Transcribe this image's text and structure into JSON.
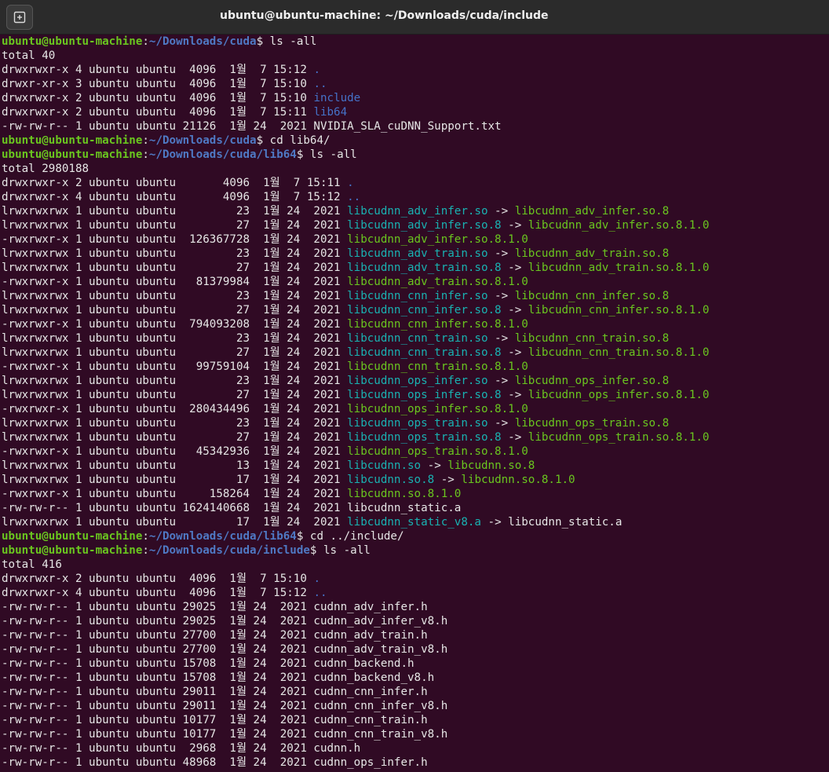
{
  "window": {
    "title": "ubuntu@ubuntu-machine: ~/Downloads/cuda/include",
    "new_tab_icon": "new-tab-icon"
  },
  "colors": {
    "background": "#300a24",
    "prompt_user": "#6ac61f",
    "prompt_path": "#4f79c4",
    "directory": "#4572c8",
    "symlink": "#19b2b2",
    "executable": "#6ac61f",
    "text": "#e6e6e6"
  },
  "terminal": {
    "lines": [
      [
        {
          "t": "ubuntu@ubuntu-machine",
          "c": "pu"
        },
        {
          "t": ":",
          "c": "plain"
        },
        {
          "t": "~/Downloads/cuda",
          "c": "pp"
        },
        {
          "t": "$ ls -all",
          "c": "plain"
        }
      ],
      [
        {
          "t": "total 40",
          "c": "plain"
        }
      ],
      [
        {
          "t": "drwxrwxr-x 4 ubuntu ubuntu  4096  1월  7 15:12 ",
          "c": "plain"
        },
        {
          "t": ".",
          "c": "dir"
        }
      ],
      [
        {
          "t": "drwxr-xr-x 3 ubuntu ubuntu  4096  1월  7 15:10 ",
          "c": "plain"
        },
        {
          "t": "..",
          "c": "dir"
        }
      ],
      [
        {
          "t": "drwxrwxr-x 2 ubuntu ubuntu  4096  1월  7 15:10 ",
          "c": "plain"
        },
        {
          "t": "include",
          "c": "dir"
        }
      ],
      [
        {
          "t": "drwxrwxr-x 2 ubuntu ubuntu  4096  1월  7 15:11 ",
          "c": "plain"
        },
        {
          "t": "lib64",
          "c": "dir"
        }
      ],
      [
        {
          "t": "-rw-rw-r-- 1 ubuntu ubuntu 21126  1월 24  2021 NVIDIA_SLA_cuDNN_Support.txt",
          "c": "plain"
        }
      ],
      [
        {
          "t": "ubuntu@ubuntu-machine",
          "c": "pu"
        },
        {
          "t": ":",
          "c": "plain"
        },
        {
          "t": "~/Downloads/cuda",
          "c": "pp"
        },
        {
          "t": "$ cd lib64/",
          "c": "plain"
        }
      ],
      [
        {
          "t": "ubuntu@ubuntu-machine",
          "c": "pu"
        },
        {
          "t": ":",
          "c": "plain"
        },
        {
          "t": "~/Downloads/cuda/lib64",
          "c": "pp"
        },
        {
          "t": "$ ls -all",
          "c": "plain"
        }
      ],
      [
        {
          "t": "total 2980188",
          "c": "plain"
        }
      ],
      [
        {
          "t": "drwxrwxr-x 2 ubuntu ubuntu       4096  1월  7 15:11 ",
          "c": "plain"
        },
        {
          "t": ".",
          "c": "dir"
        }
      ],
      [
        {
          "t": "drwxrwxr-x 4 ubuntu ubuntu       4096  1월  7 15:12 ",
          "c": "plain"
        },
        {
          "t": "..",
          "c": "dir"
        }
      ],
      [
        {
          "t": "lrwxrwxrwx 1 ubuntu ubuntu         23  1월 24  2021 ",
          "c": "plain"
        },
        {
          "t": "libcudnn_adv_infer.so",
          "c": "link"
        },
        {
          "t": " -> ",
          "c": "plain"
        },
        {
          "t": "libcudnn_adv_infer.so.8",
          "c": "exe"
        }
      ],
      [
        {
          "t": "lrwxrwxrwx 1 ubuntu ubuntu         27  1월 24  2021 ",
          "c": "plain"
        },
        {
          "t": "libcudnn_adv_infer.so.8",
          "c": "link"
        },
        {
          "t": " -> ",
          "c": "plain"
        },
        {
          "t": "libcudnn_adv_infer.so.8.1.0",
          "c": "exe"
        }
      ],
      [
        {
          "t": "-rwxrwxr-x 1 ubuntu ubuntu  126367728  1월 24  2021 ",
          "c": "plain"
        },
        {
          "t": "libcudnn_adv_infer.so.8.1.0",
          "c": "exe"
        }
      ],
      [
        {
          "t": "lrwxrwxrwx 1 ubuntu ubuntu         23  1월 24  2021 ",
          "c": "plain"
        },
        {
          "t": "libcudnn_adv_train.so",
          "c": "link"
        },
        {
          "t": " -> ",
          "c": "plain"
        },
        {
          "t": "libcudnn_adv_train.so.8",
          "c": "exe"
        }
      ],
      [
        {
          "t": "lrwxrwxrwx 1 ubuntu ubuntu         27  1월 24  2021 ",
          "c": "plain"
        },
        {
          "t": "libcudnn_adv_train.so.8",
          "c": "link"
        },
        {
          "t": " -> ",
          "c": "plain"
        },
        {
          "t": "libcudnn_adv_train.so.8.1.0",
          "c": "exe"
        }
      ],
      [
        {
          "t": "-rwxrwxr-x 1 ubuntu ubuntu   81379984  1월 24  2021 ",
          "c": "plain"
        },
        {
          "t": "libcudnn_adv_train.so.8.1.0",
          "c": "exe"
        }
      ],
      [
        {
          "t": "lrwxrwxrwx 1 ubuntu ubuntu         23  1월 24  2021 ",
          "c": "plain"
        },
        {
          "t": "libcudnn_cnn_infer.so",
          "c": "link"
        },
        {
          "t": " -> ",
          "c": "plain"
        },
        {
          "t": "libcudnn_cnn_infer.so.8",
          "c": "exe"
        }
      ],
      [
        {
          "t": "lrwxrwxrwx 1 ubuntu ubuntu         27  1월 24  2021 ",
          "c": "plain"
        },
        {
          "t": "libcudnn_cnn_infer.so.8",
          "c": "link"
        },
        {
          "t": " -> ",
          "c": "plain"
        },
        {
          "t": "libcudnn_cnn_infer.so.8.1.0",
          "c": "exe"
        }
      ],
      [
        {
          "t": "-rwxrwxr-x 1 ubuntu ubuntu  794093208  1월 24  2021 ",
          "c": "plain"
        },
        {
          "t": "libcudnn_cnn_infer.so.8.1.0",
          "c": "exe"
        }
      ],
      [
        {
          "t": "lrwxrwxrwx 1 ubuntu ubuntu         23  1월 24  2021 ",
          "c": "plain"
        },
        {
          "t": "libcudnn_cnn_train.so",
          "c": "link"
        },
        {
          "t": " -> ",
          "c": "plain"
        },
        {
          "t": "libcudnn_cnn_train.so.8",
          "c": "exe"
        }
      ],
      [
        {
          "t": "lrwxrwxrwx 1 ubuntu ubuntu         27  1월 24  2021 ",
          "c": "plain"
        },
        {
          "t": "libcudnn_cnn_train.so.8",
          "c": "link"
        },
        {
          "t": " -> ",
          "c": "plain"
        },
        {
          "t": "libcudnn_cnn_train.so.8.1.0",
          "c": "exe"
        }
      ],
      [
        {
          "t": "-rwxrwxr-x 1 ubuntu ubuntu   99759104  1월 24  2021 ",
          "c": "plain"
        },
        {
          "t": "libcudnn_cnn_train.so.8.1.0",
          "c": "exe"
        }
      ],
      [
        {
          "t": "lrwxrwxrwx 1 ubuntu ubuntu         23  1월 24  2021 ",
          "c": "plain"
        },
        {
          "t": "libcudnn_ops_infer.so",
          "c": "link"
        },
        {
          "t": " -> ",
          "c": "plain"
        },
        {
          "t": "libcudnn_ops_infer.so.8",
          "c": "exe"
        }
      ],
      [
        {
          "t": "lrwxrwxrwx 1 ubuntu ubuntu         27  1월 24  2021 ",
          "c": "plain"
        },
        {
          "t": "libcudnn_ops_infer.so.8",
          "c": "link"
        },
        {
          "t": " -> ",
          "c": "plain"
        },
        {
          "t": "libcudnn_ops_infer.so.8.1.0",
          "c": "exe"
        }
      ],
      [
        {
          "t": "-rwxrwxr-x 1 ubuntu ubuntu  280434496  1월 24  2021 ",
          "c": "plain"
        },
        {
          "t": "libcudnn_ops_infer.so.8.1.0",
          "c": "exe"
        }
      ],
      [
        {
          "t": "lrwxrwxrwx 1 ubuntu ubuntu         23  1월 24  2021 ",
          "c": "plain"
        },
        {
          "t": "libcudnn_ops_train.so",
          "c": "link"
        },
        {
          "t": " -> ",
          "c": "plain"
        },
        {
          "t": "libcudnn_ops_train.so.8",
          "c": "exe"
        }
      ],
      [
        {
          "t": "lrwxrwxrwx 1 ubuntu ubuntu         27  1월 24  2021 ",
          "c": "plain"
        },
        {
          "t": "libcudnn_ops_train.so.8",
          "c": "link"
        },
        {
          "t": " -> ",
          "c": "plain"
        },
        {
          "t": "libcudnn_ops_train.so.8.1.0",
          "c": "exe"
        }
      ],
      [
        {
          "t": "-rwxrwxr-x 1 ubuntu ubuntu   45342936  1월 24  2021 ",
          "c": "plain"
        },
        {
          "t": "libcudnn_ops_train.so.8.1.0",
          "c": "exe"
        }
      ],
      [
        {
          "t": "lrwxrwxrwx 1 ubuntu ubuntu         13  1월 24  2021 ",
          "c": "plain"
        },
        {
          "t": "libcudnn.so",
          "c": "link"
        },
        {
          "t": " -> ",
          "c": "plain"
        },
        {
          "t": "libcudnn.so.8",
          "c": "exe"
        }
      ],
      [
        {
          "t": "lrwxrwxrwx 1 ubuntu ubuntu         17  1월 24  2021 ",
          "c": "plain"
        },
        {
          "t": "libcudnn.so.8",
          "c": "link"
        },
        {
          "t": " -> ",
          "c": "plain"
        },
        {
          "t": "libcudnn.so.8.1.0",
          "c": "exe"
        }
      ],
      [
        {
          "t": "-rwxrwxr-x 1 ubuntu ubuntu     158264  1월 24  2021 ",
          "c": "plain"
        },
        {
          "t": "libcudnn.so.8.1.0",
          "c": "exe"
        }
      ],
      [
        {
          "t": "-rw-rw-r-- 1 ubuntu ubuntu 1624140668  1월 24  2021 libcudnn_static.a",
          "c": "plain"
        }
      ],
      [
        {
          "t": "lrwxrwxrwx 1 ubuntu ubuntu         17  1월 24  2021 ",
          "c": "plain"
        },
        {
          "t": "libcudnn_static_v8.a",
          "c": "link"
        },
        {
          "t": " -> libcudnn_static.a",
          "c": "plain"
        }
      ],
      [
        {
          "t": "ubuntu@ubuntu-machine",
          "c": "pu"
        },
        {
          "t": ":",
          "c": "plain"
        },
        {
          "t": "~/Downloads/cuda/lib64",
          "c": "pp"
        },
        {
          "t": "$ cd ../include/",
          "c": "plain"
        }
      ],
      [
        {
          "t": "ubuntu@ubuntu-machine",
          "c": "pu"
        },
        {
          "t": ":",
          "c": "plain"
        },
        {
          "t": "~/Downloads/cuda/include",
          "c": "pp"
        },
        {
          "t": "$ ls -all",
          "c": "plain"
        }
      ],
      [
        {
          "t": "total 416",
          "c": "plain"
        }
      ],
      [
        {
          "t": "drwxrwxr-x 2 ubuntu ubuntu  4096  1월  7 15:10 ",
          "c": "plain"
        },
        {
          "t": ".",
          "c": "dir"
        }
      ],
      [
        {
          "t": "drwxrwxr-x 4 ubuntu ubuntu  4096  1월  7 15:12 ",
          "c": "plain"
        },
        {
          "t": "..",
          "c": "dir"
        }
      ],
      [
        {
          "t": "-rw-rw-r-- 1 ubuntu ubuntu 29025  1월 24  2021 cudnn_adv_infer.h",
          "c": "plain"
        }
      ],
      [
        {
          "t": "-rw-rw-r-- 1 ubuntu ubuntu 29025  1월 24  2021 cudnn_adv_infer_v8.h",
          "c": "plain"
        }
      ],
      [
        {
          "t": "-rw-rw-r-- 1 ubuntu ubuntu 27700  1월 24  2021 cudnn_adv_train.h",
          "c": "plain"
        }
      ],
      [
        {
          "t": "-rw-rw-r-- 1 ubuntu ubuntu 27700  1월 24  2021 cudnn_adv_train_v8.h",
          "c": "plain"
        }
      ],
      [
        {
          "t": "-rw-rw-r-- 1 ubuntu ubuntu 15708  1월 24  2021 cudnn_backend.h",
          "c": "plain"
        }
      ],
      [
        {
          "t": "-rw-rw-r-- 1 ubuntu ubuntu 15708  1월 24  2021 cudnn_backend_v8.h",
          "c": "plain"
        }
      ],
      [
        {
          "t": "-rw-rw-r-- 1 ubuntu ubuntu 29011  1월 24  2021 cudnn_cnn_infer.h",
          "c": "plain"
        }
      ],
      [
        {
          "t": "-rw-rw-r-- 1 ubuntu ubuntu 29011  1월 24  2021 cudnn_cnn_infer_v8.h",
          "c": "plain"
        }
      ],
      [
        {
          "t": "-rw-rw-r-- 1 ubuntu ubuntu 10177  1월 24  2021 cudnn_cnn_train.h",
          "c": "plain"
        }
      ],
      [
        {
          "t": "-rw-rw-r-- 1 ubuntu ubuntu 10177  1월 24  2021 cudnn_cnn_train_v8.h",
          "c": "plain"
        }
      ],
      [
        {
          "t": "-rw-rw-r-- 1 ubuntu ubuntu  2968  1월 24  2021 cudnn.h",
          "c": "plain"
        }
      ],
      [
        {
          "t": "-rw-rw-r-- 1 ubuntu ubuntu 48968  1월 24  2021 cudnn_ops_infer.h",
          "c": "plain"
        }
      ]
    ]
  }
}
